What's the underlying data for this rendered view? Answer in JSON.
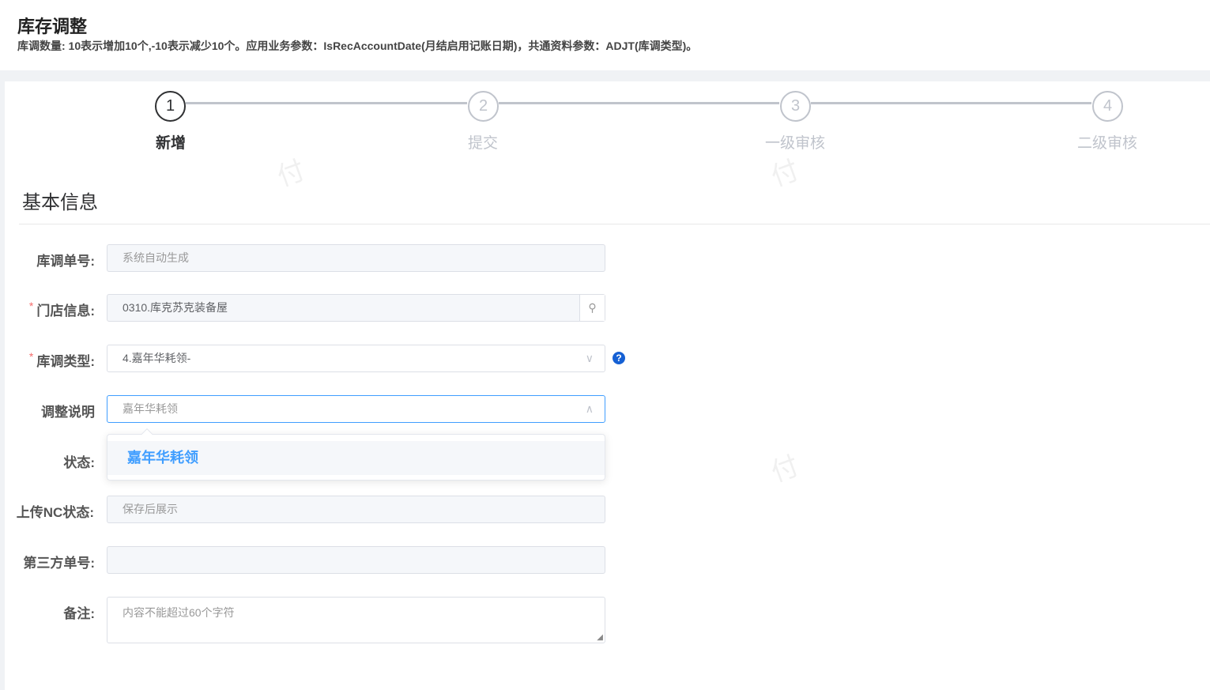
{
  "header": {
    "title": "库存调整",
    "description": "库调数量: 10表示增加10个,-10表示减少10个。应用业务参数：IsRecAccountDate(月结启用记账日期)，共通资料参数：ADJT(库调类型)。"
  },
  "steps": [
    {
      "num": "1",
      "label": "新增"
    },
    {
      "num": "2",
      "label": "提交"
    },
    {
      "num": "3",
      "label": "一级审核"
    },
    {
      "num": "4",
      "label": "二级审核"
    }
  ],
  "section": {
    "title": "基本信息"
  },
  "form": {
    "order_no": {
      "label": "库调单号:",
      "placeholder": "系统自动生成"
    },
    "store": {
      "label": "门店信息:",
      "value": "0310.库克苏克装备屋"
    },
    "type": {
      "label": "库调类型:",
      "value": "4.嘉年华耗领-"
    },
    "note": {
      "label": "调整说明",
      "placeholder": "嘉年华耗领"
    },
    "status": {
      "label": "状态:"
    },
    "nc_status": {
      "label": "上传NC状态:",
      "placeholder": "保存后展示"
    },
    "third_no": {
      "label": "第三方单号:",
      "value": ""
    },
    "remark": {
      "label": "备注:",
      "placeholder": "内容不能超过60个字符"
    }
  },
  "dropdown": {
    "options": [
      "嘉年华耗领"
    ]
  },
  "watermark": "付",
  "colors": {
    "primary": "#409eff",
    "required": "#f56c6c",
    "help": "#1560d4"
  }
}
